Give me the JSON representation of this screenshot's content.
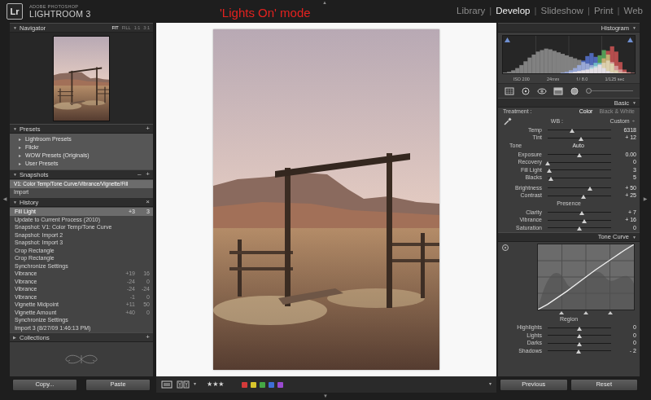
{
  "edge_arrows": {
    "top": "▲",
    "bottom": "▼",
    "left": "◀",
    "right": "▶"
  },
  "app": {
    "logo": "Lr",
    "vendor": "ADOBE PHOTOSHOP",
    "product": "LIGHTROOM 3"
  },
  "caption": "'Lights On' mode",
  "modules": {
    "separator": "|",
    "items": [
      {
        "label": "Library",
        "selected": false
      },
      {
        "label": "Develop",
        "selected": true
      },
      {
        "label": "Slideshow",
        "selected": false
      },
      {
        "label": "Print",
        "selected": false
      },
      {
        "label": "Web",
        "selected": false
      }
    ]
  },
  "left_panel": {
    "navigator": {
      "title": "Navigator",
      "arrow": "▼",
      "expanded": true,
      "zoom": [
        {
          "label": "FIT",
          "selected": true
        },
        {
          "label": "FILL",
          "selected": false
        },
        {
          "label": "1:1",
          "selected": false
        },
        {
          "label": "3:1",
          "selected": false
        }
      ]
    },
    "presets": {
      "title": "Presets",
      "arrow": "▼",
      "expanded": true,
      "actions": [
        "+"
      ],
      "items": [
        {
          "label": "Lightroom Presets",
          "arrow": "►",
          "expanded": false
        },
        {
          "label": "Flickr",
          "arrow": "►",
          "expanded": false
        },
        {
          "label": "WOW Presets (Originals)",
          "arrow": "►",
          "expanded": false
        },
        {
          "label": "User Presets",
          "arrow": "►",
          "expanded": false
        }
      ]
    },
    "snapshots": {
      "title": "Snapshots",
      "arrow": "▼",
      "expanded": true,
      "actions": [
        "–",
        "+"
      ],
      "items": [
        {
          "label": "V1: Color Temp/Tone Curve/Vibrance/Vignette/Fill",
          "selected": true
        },
        {
          "label": "Import",
          "selected": false
        }
      ]
    },
    "history": {
      "title": "History",
      "arrow": "▼",
      "expanded": true,
      "actions": [
        "×"
      ],
      "items": [
        {
          "label": "Fill Light",
          "before": "+3",
          "after": "3",
          "selected": true
        },
        {
          "label": "Update to Current Process (2010)",
          "selected": false
        },
        {
          "label": "Snapshot: V1: Color Temp/Tone Curve",
          "selected": false
        },
        {
          "label": "Snapshot: Import 2",
          "selected": false
        },
        {
          "label": "Snapshot: Import 3",
          "selected": false
        },
        {
          "label": "Crop Rectangle",
          "selected": false
        },
        {
          "label": "Crop Rectangle",
          "selected": false
        },
        {
          "label": "Synchronize Settings",
          "selected": false
        },
        {
          "label": "Vibrance",
          "before": "+19",
          "after": "16",
          "selected": false
        },
        {
          "label": "Vibrance",
          "before": "-24",
          "after": "0",
          "selected": false
        },
        {
          "label": "Vibrance",
          "before": "-24",
          "after": "-24",
          "selected": false
        },
        {
          "label": "Vibrance",
          "before": "-1",
          "after": "0",
          "selected": false
        },
        {
          "label": "Vignette Midpoint",
          "before": "+11",
          "after": "50",
          "selected": false
        },
        {
          "label": "Vignette Amount",
          "before": "+40",
          "after": "0",
          "selected": false
        },
        {
          "label": "Synchronize Settings",
          "selected": false
        },
        {
          "label": "Import 3 (8/27/09 1:46:13 PM)",
          "selected": false
        }
      ]
    },
    "collections": {
      "title": "Collections",
      "arrow": "▶",
      "expanded": false,
      "actions": [
        "+"
      ]
    },
    "buttons": [
      "Copy...",
      "Paste"
    ]
  },
  "right_panel": {
    "histogram": {
      "title": "Histogram",
      "arrow": "▼",
      "expanded": true,
      "series": [
        {
          "color": "#8c8c8c",
          "values": [
            2,
            4,
            8,
            14,
            22,
            32,
            42,
            50,
            58,
            62,
            66,
            64,
            60,
            56,
            52,
            48,
            44,
            40,
            36,
            30,
            26,
            22,
            20,
            22,
            28,
            34,
            30,
            20,
            10,
            4,
            2,
            1
          ]
        },
        {
          "color": "#d23a3a",
          "values": [
            0,
            0,
            0,
            0,
            0,
            0,
            0,
            0,
            0,
            0,
            0,
            0,
            0,
            0,
            0,
            0,
            2,
            4,
            6,
            8,
            10,
            12,
            16,
            24,
            40,
            60,
            72,
            58,
            30,
            10,
            3,
            1
          ]
        },
        {
          "color": "#3fae45",
          "values": [
            0,
            0,
            0,
            0,
            0,
            0,
            0,
            0,
            0,
            0,
            0,
            0,
            0,
            0,
            0,
            0,
            2,
            4,
            6,
            8,
            10,
            16,
            28,
            48,
            62,
            50,
            26,
            8,
            2,
            1,
            0,
            0
          ]
        },
        {
          "color": "#3c62d6",
          "values": [
            0,
            0,
            0,
            0,
            0,
            0,
            0,
            0,
            0,
            0,
            0,
            0,
            0,
            0,
            2,
            4,
            8,
            14,
            22,
            34,
            46,
            54,
            44,
            28,
            14,
            6,
            2,
            1,
            0,
            0,
            0,
            0
          ]
        }
      ],
      "info": [
        "ISO 200",
        "24mm",
        "f / 8.0",
        "1/125 sec"
      ]
    },
    "basic": {
      "title": "Basic",
      "arrow": "▼",
      "expanded": true,
      "treatment": {
        "label": "Treatment :",
        "options": [
          {
            "label": "Color",
            "selected": true
          },
          {
            "label": "Black & White",
            "selected": false
          }
        ]
      },
      "wb": {
        "label": "WB :",
        "value": "Custom",
        "spinner": "÷"
      },
      "wb_sliders": [
        {
          "label": "Temp",
          "value": "6318",
          "level": 0.38
        },
        {
          "label": "Tint",
          "value": "+ 12",
          "level": 0.53
        }
      ],
      "tone": {
        "label": "Tone",
        "auto": "Auto"
      },
      "tone_sliders": [
        {
          "label": "Exposure",
          "value": "0.00",
          "level": 0.5
        },
        {
          "label": "Recovery",
          "value": "0",
          "level": 0.0
        },
        {
          "label": "Fill Light",
          "value": "3",
          "level": 0.03
        },
        {
          "label": "Blacks",
          "value": "5",
          "level": 0.05
        }
      ],
      "contrast_sliders": [
        {
          "label": "Brightness",
          "value": "+ 50",
          "level": 0.67
        },
        {
          "label": "Contrast",
          "value": "+ 25",
          "level": 0.56
        }
      ],
      "presence": {
        "label": "Presence"
      },
      "presence_sliders": [
        {
          "label": "Clarity",
          "value": "+ 7",
          "level": 0.535
        },
        {
          "label": "Vibrance",
          "value": "+ 16",
          "level": 0.58
        },
        {
          "label": "Saturation",
          "value": "0",
          "level": 0.5
        }
      ]
    },
    "tone_curve": {
      "title": "Tone Curve",
      "arrow": "▼",
      "expanded": true,
      "curve": [
        0,
        8,
        18,
        28,
        39,
        50,
        61,
        71,
        81,
        91,
        100
      ],
      "splits": [
        {
          "level": 0.25
        },
        {
          "level": 0.5
        },
        {
          "level": 0.75
        }
      ],
      "region_label": "Region",
      "sliders": [
        {
          "label": "Highlights",
          "value": "0",
          "level": 0.5
        },
        {
          "label": "Lights",
          "value": "0",
          "level": 0.5
        },
        {
          "label": "Darks",
          "value": "0",
          "level": 0.5
        },
        {
          "label": "Shadows",
          "value": "- 2",
          "level": 0.49
        }
      ]
    },
    "buttons": [
      "Previous",
      "Reset"
    ]
  },
  "toolbar": {
    "menu_arrow": "▾",
    "star": "★",
    "stars": 3,
    "color_labels": [
      {
        "color": "#d43a3a"
      },
      {
        "color": "#d8c52c"
      },
      {
        "color": "#45a845"
      },
      {
        "color": "#3e6fd6"
      },
      {
        "color": "#9a4ad0"
      }
    ],
    "end_arrow": "▾"
  }
}
